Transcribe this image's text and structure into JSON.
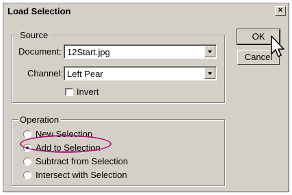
{
  "dialog": {
    "title": "Load Selection",
    "close_label": "×"
  },
  "source": {
    "legend": "Source",
    "document_label": "Document:",
    "document_value": "12Start.jpg",
    "channel_label": "Channel:",
    "channel_value": "Left Pear",
    "invert_label": "Invert",
    "invert_checked": false
  },
  "operation": {
    "legend": "Operation",
    "options": [
      {
        "label": "New Selection",
        "checked": false
      },
      {
        "label": "Add to Selection",
        "checked": true
      },
      {
        "label": "Subtract from Selection",
        "checked": false
      },
      {
        "label": "Intersect with Selection",
        "checked": false
      }
    ]
  },
  "buttons": {
    "ok": "OK",
    "cancel": "Cancel"
  },
  "colors": {
    "dialog_bg": "#d4d0c8",
    "highlight": "#b0187a"
  },
  "icons": [
    "close-icon",
    "dropdown-arrow-icon",
    "mouse-pointer-icon"
  ]
}
